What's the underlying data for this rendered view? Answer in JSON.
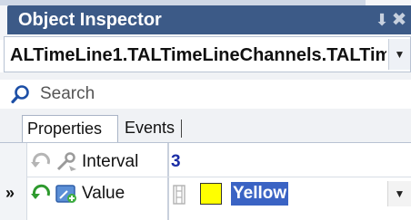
{
  "panel": {
    "title": "Object Inspector",
    "pin_glyph": "⬇",
    "close_glyph": "✖"
  },
  "component_selector": {
    "value": "ALTimeLine1.TALTimeLineChannels.TALTim",
    "dropdown_glyph": "▼"
  },
  "search": {
    "placeholder": "Search",
    "icon": "search-icon"
  },
  "tabs": [
    {
      "label": "Properties",
      "active": true
    },
    {
      "label": "Events",
      "active": false
    }
  ],
  "properties": [
    {
      "name": "Interval",
      "value": "3"
    },
    {
      "name": "Value",
      "value": "Yellow",
      "color": "#ffff00",
      "selected": true
    }
  ],
  "current_row_marker": "»",
  "value_dropdown_glyph": "▼",
  "colors": {
    "title_bar": "#3c5a87",
    "value_text": "#1b2ea6",
    "selection": "#3a63c4"
  }
}
